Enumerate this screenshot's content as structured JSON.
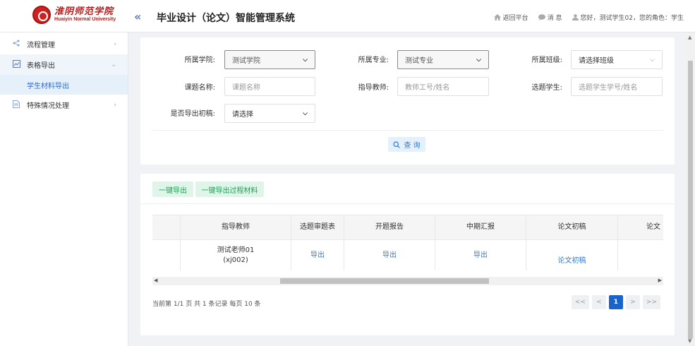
{
  "header": {
    "logo_cn": "淮阴师范学院",
    "logo_en": "Huaiyin Normal University",
    "collapse_icon": "«",
    "title": "毕业设计（论文）智能管理系统",
    "return_label": "返回平台",
    "message_label": "消 息",
    "user_greeting": "您好，测试学生02，您的角色：学生"
  },
  "sidebar": {
    "items": [
      {
        "label": "流程管理",
        "icon": "share-icon"
      },
      {
        "label": "表格导出",
        "icon": "chart-icon",
        "children": [
          {
            "label": "学生材料导出"
          }
        ]
      },
      {
        "label": "特殊情况处理",
        "icon": "document-icon"
      }
    ]
  },
  "filters": {
    "college_label": "所属学院:",
    "college_value": "测试学院",
    "major_label": "所属专业:",
    "major_value": "测试专业",
    "class_label": "所属班级:",
    "class_placeholder": "请选择班级",
    "topic_label": "课题名称:",
    "topic_placeholder": "课题名称",
    "teacher_label": "指导教师:",
    "teacher_placeholder": "教师工号/姓名",
    "student_label": "选题学生:",
    "student_placeholder": "选题学生学号/姓名",
    "draft_label": "是否导出初稿:",
    "draft_value": "请选择",
    "query_label": "查 询"
  },
  "actions": {
    "export_one_label": "一键导出",
    "export_process_label": "一键导出过程材料"
  },
  "table": {
    "columns": [
      "",
      "指导教师",
      "选题审题表",
      "开题报告",
      "中期汇报",
      "论文初稿",
      "论文"
    ],
    "rows": [
      {
        "blank": "",
        "teacher_name": "测试老师01",
        "teacher_id": "(xj002)",
        "review": "导出",
        "proposal": "导出",
        "midterm": "导出",
        "draft": "论文初稿"
      }
    ]
  },
  "pagination": {
    "info": "当前第 1/1 页 共 1 条记录 每页 10 条",
    "first": "<<",
    "prev": "<",
    "current": "1",
    "next": ">",
    "last": ">>"
  },
  "colors": {
    "accent": "#1a63c8",
    "link": "#2f7bd6",
    "green_btn_bg": "#e0f5ea",
    "green_btn_text": "#1f9d55",
    "logo_red": "#b71c1c"
  }
}
